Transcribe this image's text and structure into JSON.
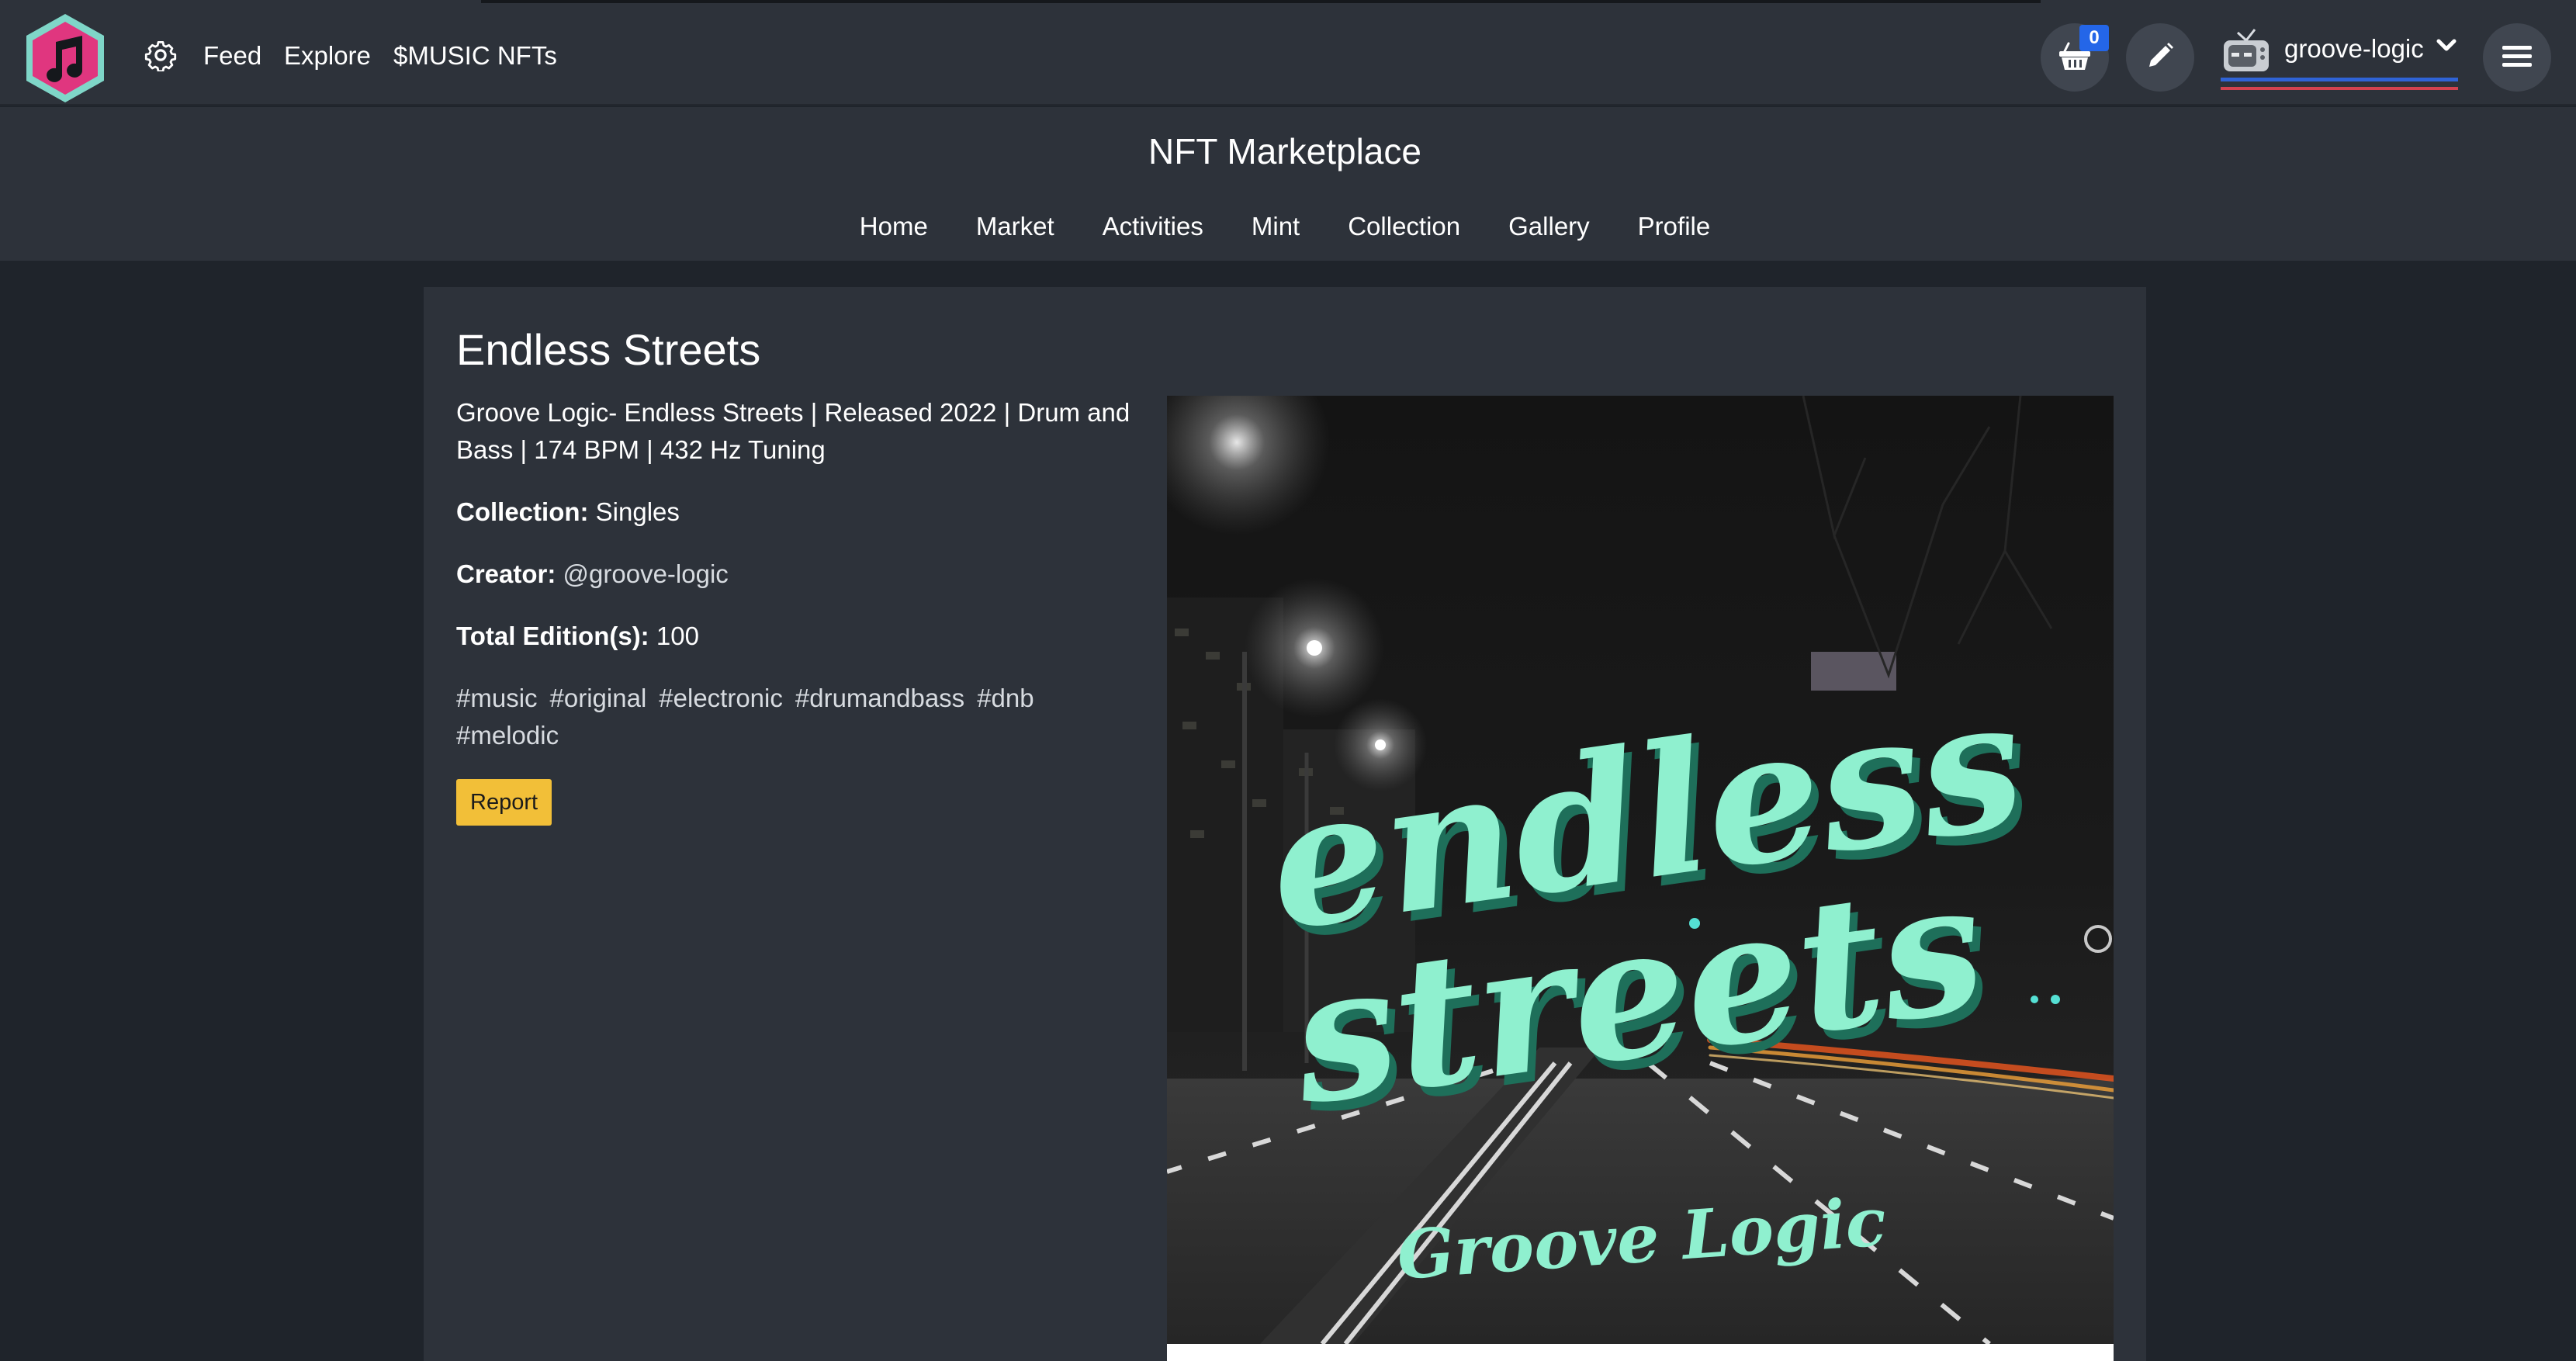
{
  "topbar": {
    "links": [
      "Feed",
      "Explore",
      "$MUSIC NFTs"
    ],
    "cart_count": "0",
    "username": "groove-logic"
  },
  "market": {
    "title": "NFT Marketplace",
    "nav": [
      "Home",
      "Market",
      "Activities",
      "Mint",
      "Collection",
      "Gallery",
      "Profile"
    ]
  },
  "nft": {
    "title": "Endless Streets",
    "description": "Groove Logic- Endless Streets | Released 2022 | Drum and Bass | 174 BPM | 432 Hz Tuning",
    "collection_label": "Collection:",
    "collection_value": "Singles",
    "creator_label": "Creator:",
    "creator_value": "@groove-logic",
    "editions_label": "Total Edition(s):",
    "editions_value": "100",
    "tags": [
      "#music",
      "#original",
      "#electronic",
      "#drumandbass",
      "#dnb",
      "#melodic"
    ],
    "report_label": "Report",
    "art_title_1": "endless",
    "art_title_2": "streets",
    "art_artist": "Groove Logic"
  },
  "colors": {
    "page_bg": "#1f242b",
    "panel_bg": "#2d323a",
    "accent_yellow": "#f2bf38",
    "badge_blue": "#2466e8",
    "logo_pink": "#e0367f",
    "logo_teal": "#7fd6c8",
    "art_mint": "#8ff0cf"
  },
  "icons": {
    "logo": "music-note-hexagon-icon",
    "settings": "gear-icon",
    "cart": "basket-icon",
    "edit": "pencil-icon",
    "avatar": "tv-avatar-icon",
    "dropdown": "chevron-down-icon",
    "menu": "hamburger-icon"
  }
}
